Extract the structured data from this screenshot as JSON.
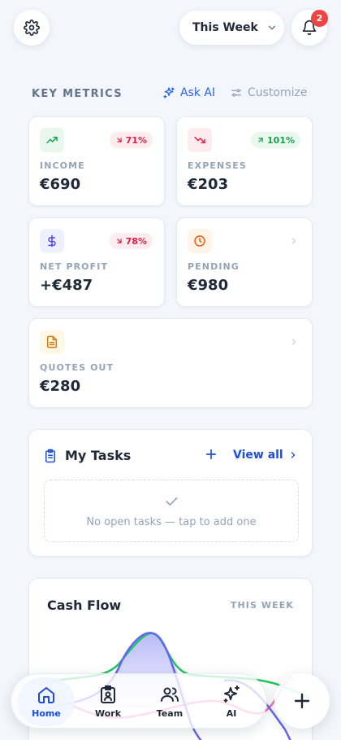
{
  "header": {
    "period_label": "This Week",
    "notification_count": "2"
  },
  "metrics": {
    "section_title": "KEY METRICS",
    "ask_ai_label": "Ask AI",
    "customize_label": "Customize",
    "cards": [
      {
        "label": "INCOME",
        "value": "€690",
        "change": "71%",
        "trend": "down",
        "icon": "trending-up-icon",
        "icon_color": "#16a34a",
        "icon_bg": "#e8f8ef"
      },
      {
        "label": "EXPENSES",
        "value": "€203",
        "change": "101%",
        "trend": "up",
        "icon": "trending-down-icon",
        "icon_color": "#e11d48",
        "icon_bg": "#fdecef"
      },
      {
        "label": "NET PROFIT",
        "value": "+€487",
        "change": "78%",
        "trend": "down",
        "icon": "dollar-icon",
        "icon_color": "#4f46e5",
        "icon_bg": "#eef0fb"
      },
      {
        "label": "PENDING",
        "value": "€980",
        "icon": "clock-icon",
        "icon_color": "#ea580c",
        "icon_bg": "#fff4e8"
      },
      {
        "label": "QUOTES OUT",
        "value": "€280",
        "icon": "document-icon",
        "icon_color": "#d97706",
        "icon_bg": "#fff8e6"
      }
    ]
  },
  "tasks": {
    "title": "My Tasks",
    "view_all_label": "View all",
    "empty_text": "No open tasks — tap to add one"
  },
  "cash_flow": {
    "title": "Cash Flow",
    "period": "THIS WEEK",
    "colors": {
      "income": "#22c55e",
      "expenses": "#f472b6",
      "net": "#6366f1"
    }
  },
  "nav": {
    "items": [
      {
        "label": "Home",
        "icon": "home-icon",
        "active": true
      },
      {
        "label": "Work",
        "icon": "clipboard-icon",
        "active": false
      },
      {
        "label": "Team",
        "icon": "team-icon",
        "active": false
      },
      {
        "label": "AI",
        "icon": "sparkle-icon",
        "active": false
      }
    ]
  }
}
